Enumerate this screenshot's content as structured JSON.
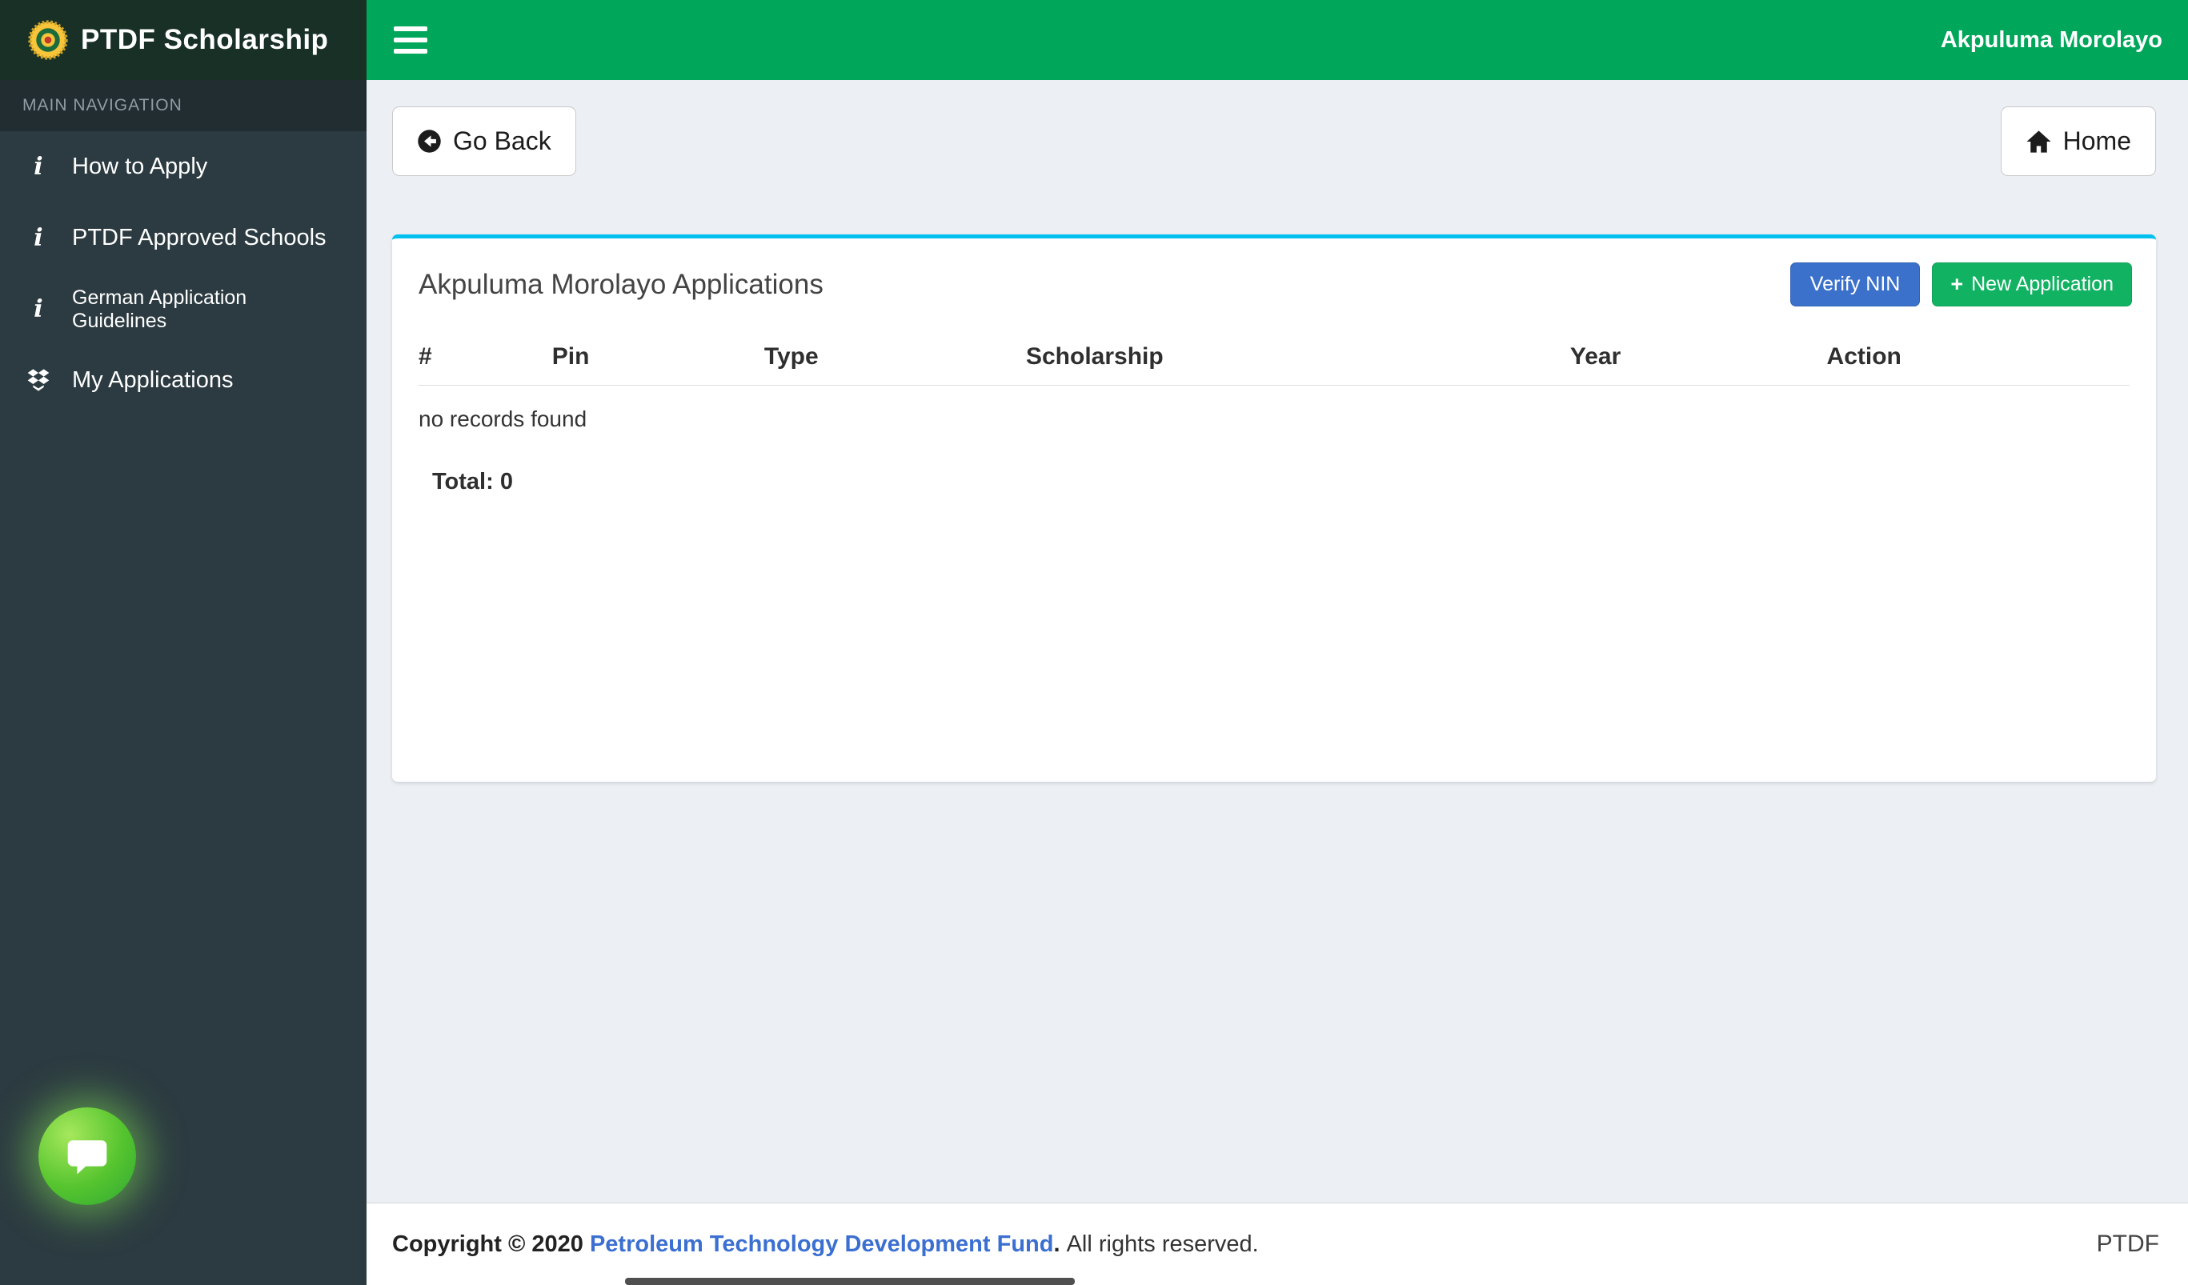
{
  "header": {
    "brand": "PTDF Scholarship",
    "user": "Akpuluma Morolayo"
  },
  "sidebar": {
    "section_label": "MAIN NAVIGATION",
    "items": [
      {
        "label": "How to Apply",
        "icon": "info-icon"
      },
      {
        "label": "PTDF Approved Schools",
        "icon": "info-icon"
      },
      {
        "label": "German Application Guidelines",
        "icon": "info-icon"
      },
      {
        "label": "My Applications",
        "icon": "box-icon"
      }
    ]
  },
  "toolbar": {
    "go_back_label": "Go Back",
    "home_label": "Home"
  },
  "panel": {
    "title": "Akpuluma Morolayo Applications",
    "verify_nin_label": "Verify NIN",
    "new_application_label": "New Application",
    "table": {
      "columns": [
        "#",
        "Pin",
        "Type",
        "Scholarship",
        "Year",
        "Action"
      ],
      "rows": [],
      "empty_text": "no records found",
      "total_label": "Total: 0"
    }
  },
  "footer": {
    "copyright_prefix": "Copyright © 2020",
    "link_text": "Petroleum Technology Development Fund",
    "dot": ".",
    "suffix": " All rights reserved.",
    "right_text": "PTDF"
  },
  "icons": {
    "info": "i",
    "plus": "+"
  },
  "colors": {
    "header_green": "#00a65a",
    "logo_bg": "#183026",
    "sidebar_bg": "#2c3b41",
    "sidebar_section_bg": "#222d32",
    "content_bg": "#ecf0f5",
    "panel_accent_cyan": "#00c0ef",
    "primary_button_blue": "#3b71ca",
    "success_button_green": "#12b263",
    "footer_link_blue": "#3b6fd1",
    "chat_fab_green": "#55c42e"
  }
}
